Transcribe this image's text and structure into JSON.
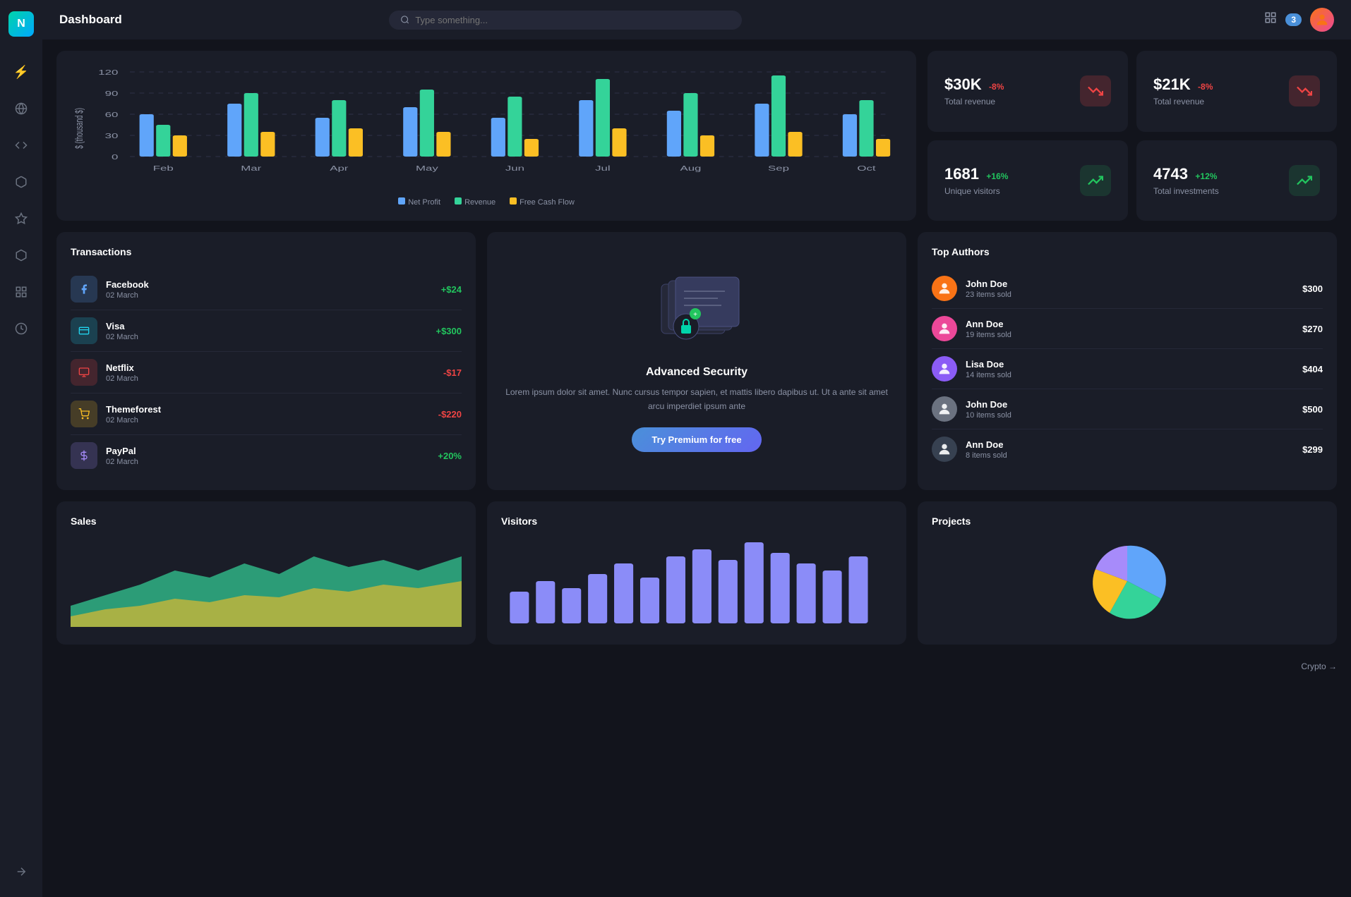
{
  "app": {
    "logo": "N",
    "title": "Dashboard",
    "search_placeholder": "Type something...",
    "notification_count": "3"
  },
  "sidebar": {
    "items": [
      {
        "name": "activity-icon",
        "icon": "⚡",
        "active": true
      },
      {
        "name": "globe-icon",
        "icon": "🌐",
        "active": false
      },
      {
        "name": "code-icon",
        "icon": "</>",
        "active": false
      },
      {
        "name": "package-icon",
        "icon": "⬡",
        "active": false
      },
      {
        "name": "star-icon",
        "icon": "☆",
        "active": false
      },
      {
        "name": "hexagon-icon",
        "icon": "⬡",
        "active": false
      },
      {
        "name": "grid-icon",
        "icon": "⊞",
        "active": false
      },
      {
        "name": "clock-icon",
        "icon": "◷",
        "active": false
      }
    ],
    "bottom_icon": "→"
  },
  "chart": {
    "y_labels": [
      "0",
      "30",
      "60",
      "90",
      "120"
    ],
    "x_labels": [
      "Feb",
      "Mar",
      "Apr",
      "May",
      "Jun",
      "Jul",
      "Aug",
      "Sep",
      "Oct"
    ],
    "legend": [
      {
        "label": "Net Profit",
        "color": "#60a5fa"
      },
      {
        "label": "Revenue",
        "color": "#34d399"
      },
      {
        "label": "Free Cash Flow",
        "color": "#fbbf24"
      }
    ]
  },
  "stats": [
    {
      "value": "$30K",
      "change": "-8%",
      "change_type": "negative",
      "label": "Total revenue",
      "icon_type": "red",
      "icon": "↘"
    },
    {
      "value": "$21K",
      "change": "-8%",
      "change_type": "negative",
      "label": "Total revenue",
      "icon_type": "red",
      "icon": "↘"
    },
    {
      "value": "1681",
      "change": "+16%",
      "change_type": "positive",
      "label": "Unique visitors",
      "icon_type": "green",
      "icon": "↗"
    },
    {
      "value": "4743",
      "change": "+12%",
      "change_type": "positive",
      "label": "Total investments",
      "icon_type": "green",
      "icon": "↗"
    }
  ],
  "transactions": {
    "title": "Transactions",
    "items": [
      {
        "name": "Facebook",
        "date": "02 March",
        "amount": "+$24",
        "type": "pos",
        "icon": "👍",
        "icon_style": "blue"
      },
      {
        "name": "Visa",
        "date": "02 March",
        "amount": "+$300",
        "type": "pos",
        "icon": "💳",
        "icon_style": "teal"
      },
      {
        "name": "Netflix",
        "date": "02 March",
        "amount": "-$17",
        "type": "neg",
        "icon": "🎬",
        "icon_style": "red"
      },
      {
        "name": "Themeforest",
        "date": "02 March",
        "amount": "-$220",
        "type": "neg",
        "icon": "🛒",
        "icon_style": "orange"
      },
      {
        "name": "PayPal",
        "date": "02 March",
        "amount": "+20%",
        "type": "pos",
        "icon": "$",
        "icon_style": "purple"
      }
    ]
  },
  "security": {
    "title": "Advanced Security",
    "description": "Lorem ipsum dolor sit amet. Nunc cursus tempor sapien, et mattis libero dapibus ut. Ut a ante sit amet arcu imperdiet ipsum ante",
    "button_label": "Try Premium for free"
  },
  "authors": {
    "title": "Top Authors",
    "items": [
      {
        "name": "John Doe",
        "items_sold": "23 items sold",
        "amount": "$300",
        "avatar_color": "#f97316"
      },
      {
        "name": "Ann Doe",
        "items_sold": "19 items sold",
        "amount": "$270",
        "avatar_color": "#ec4899"
      },
      {
        "name": "Lisa Doe",
        "items_sold": "14 items sold",
        "amount": "$404",
        "avatar_color": "#8b5cf6"
      },
      {
        "name": "John Doe",
        "items_sold": "10 items sold",
        "amount": "$500",
        "avatar_color": "#6b7280"
      },
      {
        "name": "Ann Doe",
        "items_sold": "8 items sold",
        "amount": "$299",
        "avatar_color": "#374151"
      }
    ]
  },
  "sales": {
    "title": "Sales"
  },
  "visitors": {
    "title": "Visitors"
  },
  "projects": {
    "title": "Projects"
  },
  "footer": {
    "label": "Crypto →"
  }
}
